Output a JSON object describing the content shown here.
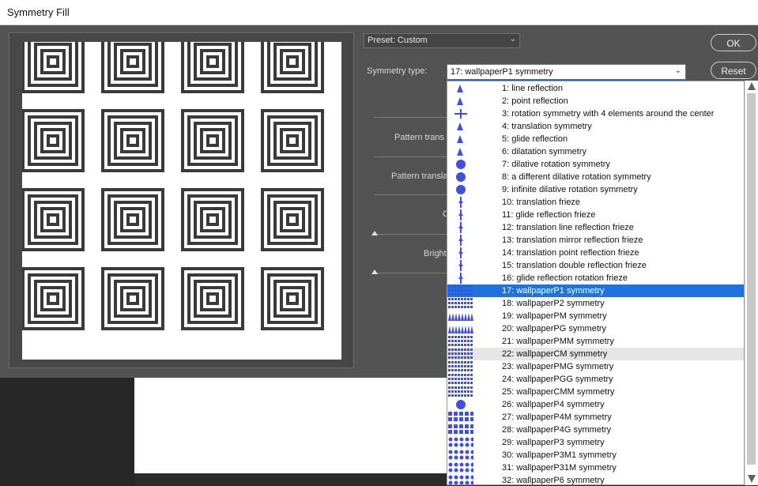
{
  "window": {
    "title": "Symmetry Fill"
  },
  "buttons": {
    "ok_label": "OK",
    "reset_label": "Reset"
  },
  "preset": {
    "value": "Preset: Custom"
  },
  "symmetry": {
    "label": "Symmetry type:",
    "value": "17: wallpaperP1 symmetry"
  },
  "controls": {
    "pattern_trans_1": "Pattern trans",
    "pattern_transl_2": "Pattern transla",
    "c_label": "C",
    "bright_label": "Bright"
  },
  "dropdown": {
    "selected_index": 16,
    "hover_index": 21,
    "accent_color": "#1e73e0",
    "thumb_color": "#3f4fe0",
    "items": [
      {
        "label": "1: line reflection"
      },
      {
        "label": "2: point reflection"
      },
      {
        "label": "3: rotation symmetry with 4 elements around the center"
      },
      {
        "label": "4: translation symmetry"
      },
      {
        "label": "5: glide reflection"
      },
      {
        "label": "6: dilatation symmetry"
      },
      {
        "label": "7: dilative rotation symmetry"
      },
      {
        "label": "8: a different dilative rotation  symmetry"
      },
      {
        "label": "9: infinite dilative rotation symmetry"
      },
      {
        "label": "10: translation frieze"
      },
      {
        "label": "11: glide reflection frieze"
      },
      {
        "label": "12: translation line reflection frieze"
      },
      {
        "label": "13: translation mirror reflection frieze"
      },
      {
        "label": "14: translation point reflection frieze"
      },
      {
        "label": "15: translation double reflection frieze"
      },
      {
        "label": "16: glide reflection rotation frieze"
      },
      {
        "label": "17: wallpaperP1 symmetry"
      },
      {
        "label": "18: wallpaperP2 symmetry"
      },
      {
        "label": "19: wallpaperPM symmetry"
      },
      {
        "label": "20: wallpaperPG symmetry"
      },
      {
        "label": "21: wallpaperPMM symmetry"
      },
      {
        "label": "22: wallpaperCM symmetry"
      },
      {
        "label": "23: wallpaperPMG symmetry"
      },
      {
        "label": "24: wallpaperPGG symmetry"
      },
      {
        "label": "25: wallpaperCMM symmetry"
      },
      {
        "label": "26: wallpaperP4 symmetry"
      },
      {
        "label": "27: wallpaperP4M symmetry"
      },
      {
        "label": "28: wallpaperP4G symmetry"
      },
      {
        "label": "29: wallpaperP3 symmetry"
      },
      {
        "label": "30: wallpaperP3M1 symmetry"
      },
      {
        "label": "31: wallpaperP31M symmetry"
      },
      {
        "label": "32: wallpaperP6 symmetry"
      }
    ]
  }
}
